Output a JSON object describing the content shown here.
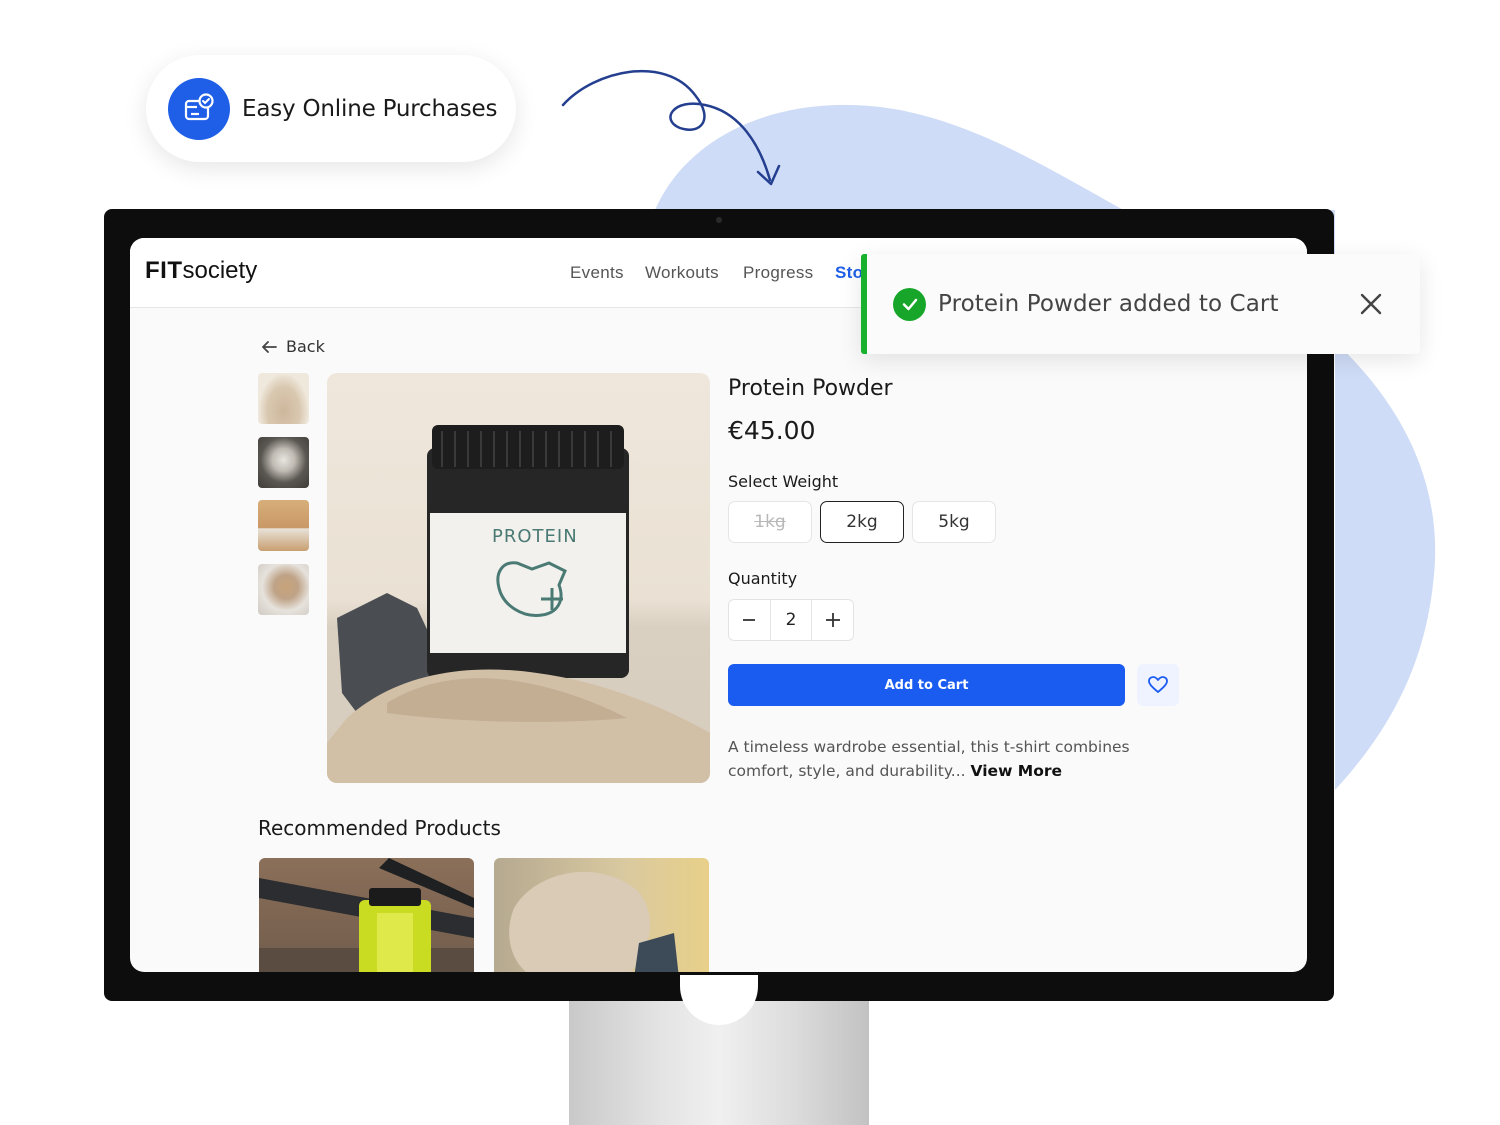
{
  "badge": {
    "label": "Easy Online Purchases",
    "icon": "card-check-icon"
  },
  "app": {
    "logo_bold": "FIT",
    "logo_light": "society",
    "nav": [
      "Events",
      "Workouts",
      "Progress",
      "Sto"
    ],
    "active_nav": "Sto"
  },
  "page": {
    "back_label": "Back",
    "product_title": "Protein Powder",
    "price": "€45.00",
    "jar_label": "PROTEIN",
    "weight_label": "Select Weight",
    "weights": [
      {
        "label": "1kg",
        "state": "unavailable"
      },
      {
        "label": "2kg",
        "state": "selected"
      },
      {
        "label": "5kg",
        "state": "available"
      }
    ],
    "quantity_label": "Quantity",
    "quantity_value": "2",
    "add_to_cart_label": "Add to Cart",
    "description": "A timeless wardrobe essential, this t-shirt combines comfort, style, and durability...",
    "view_more": "View More",
    "recommended_title": "Recommended Products"
  },
  "toast": {
    "message": "Protein Powder added to Cart"
  },
  "colors": {
    "accent": "#1a5cf0",
    "success": "#17b12d",
    "blob": "#cfdcf7"
  }
}
